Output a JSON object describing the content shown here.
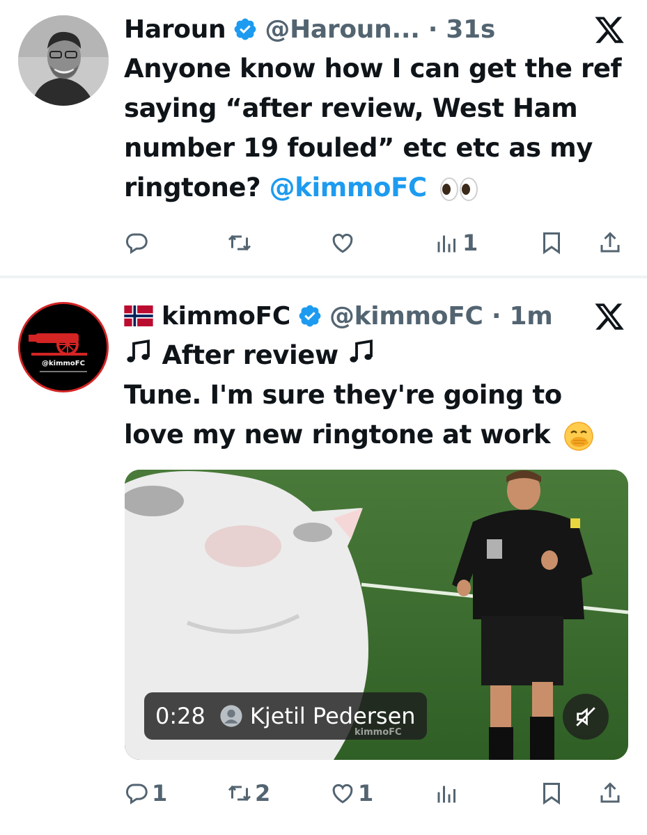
{
  "tweets": [
    {
      "name": "Haroun",
      "handle": "@Haroun...",
      "time_sep": " · ",
      "time": "31s",
      "text_lines": [
        "Anyone know how I can get the ref",
        "saying “after review, West Ham",
        "number 19 fouled” etc etc as my",
        "ringtone?"
      ],
      "mention": "@kimmoFC",
      "emoji": "eyes-emoji",
      "actions": {
        "reply": "",
        "retweet": "",
        "like": "",
        "views": "1"
      }
    },
    {
      "flag": "norway-flag",
      "name": "kimmoFC",
      "handle": "@kimmoFC",
      "time_sep": " · ",
      "time": "1m",
      "text_line1": "After review",
      "text_lines": [
        "Tune. I'm sure they're going to",
        "love my new ringtone at work"
      ],
      "emoji": "face-with-hand-over-mouth-emoji",
      "avatar_text": "@kimmoFC",
      "video": {
        "duration": "0:28",
        "author": "Kjetil Pedersen",
        "watermark": "kimmoFC"
      },
      "actions": {
        "reply": "1",
        "retweet": "2",
        "like": "1",
        "views": ""
      }
    }
  ],
  "colors": {
    "text": "#0f1419",
    "secondary": "#536471",
    "accent": "#1d9bf0",
    "divider": "#eff3f4"
  }
}
